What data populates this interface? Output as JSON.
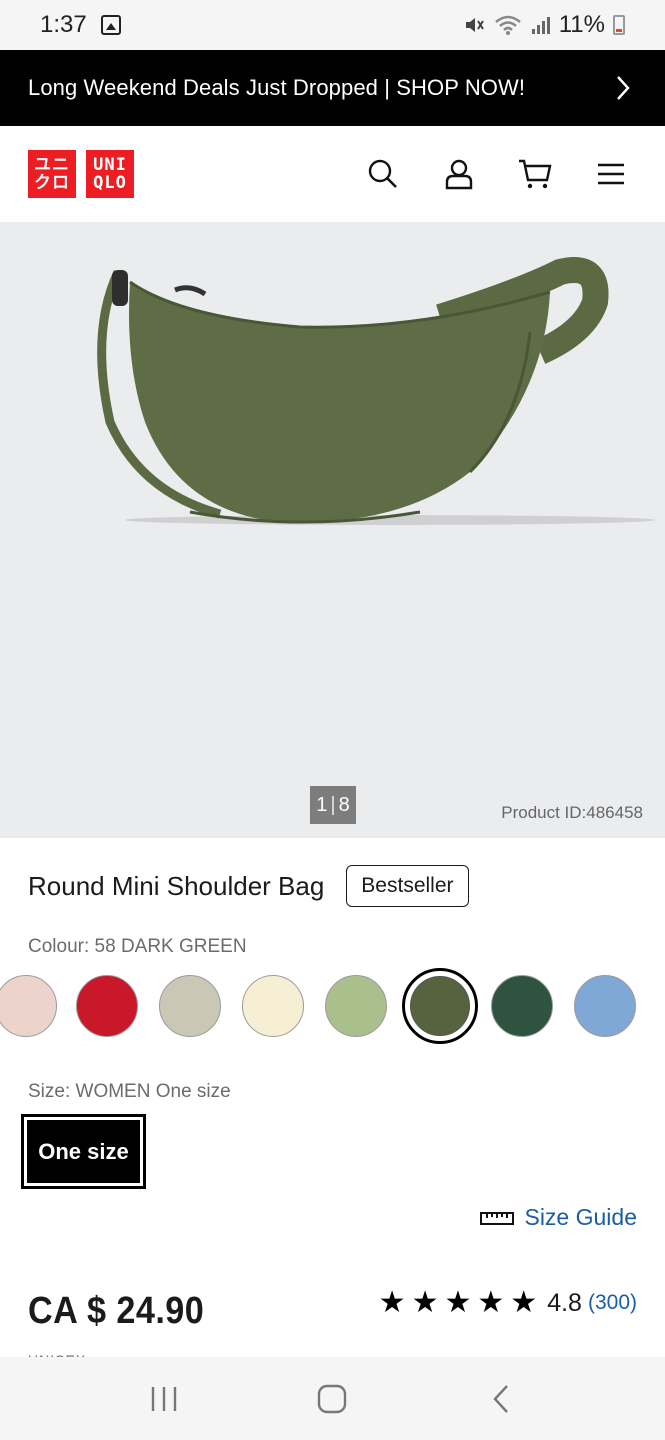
{
  "status_bar": {
    "time": "1:37",
    "battery_pct": "11%"
  },
  "promo": {
    "text": "Long Weekend Deals Just Dropped | SHOP NOW!"
  },
  "header": {
    "logo_top_left": "ユニ",
    "logo_bottom_left": "クロ",
    "logo_top_right": "UNI",
    "logo_bottom_right": "QLO",
    "icons": [
      "search-icon",
      "account-icon",
      "cart-icon",
      "menu-icon"
    ]
  },
  "gallery": {
    "counter_current": "1",
    "counter_total": "8",
    "product_id": "Product ID:486458"
  },
  "product": {
    "title": "Round Mini Shoulder Bag",
    "badge": "Bestseller",
    "colour_label": "Colour: 58 DARK GREEN",
    "colours": [
      "#ecd3cb",
      "#c8182a",
      "#cbc7b6",
      "#f7efd4",
      "#a9c08d",
      "#56633e",
      "#2e5440",
      "#7fa8d6"
    ],
    "selected_colour_index": 5,
    "size_label": "Size: WOMEN One size",
    "size_option": "One size",
    "size_guide": "Size Guide",
    "price": "CA $ 24.90",
    "rating": "4.8",
    "rating_count": "(300)",
    "stars": 5,
    "cutoff_text": "UNISEX"
  },
  "colors": {
    "accent_link": "#1a5ea8",
    "brand_red": "#ed1d24",
    "bag_green": "#5b6a43"
  }
}
